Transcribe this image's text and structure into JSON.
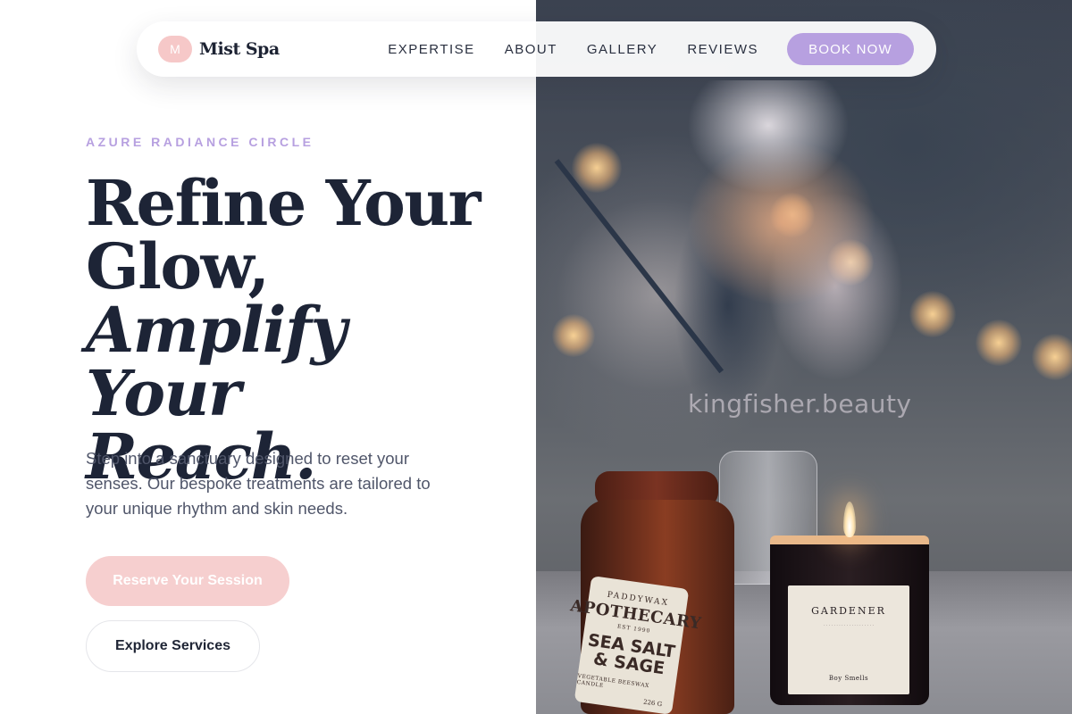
{
  "brand": {
    "logo_letter": "M",
    "name": "Mist Spa"
  },
  "nav": {
    "links": [
      "EXPERTISE",
      "ABOUT",
      "GALLERY",
      "REVIEWS"
    ],
    "cta": "BOOK NOW"
  },
  "hero": {
    "eyebrow": "AZURE RADIANCE CIRCLE",
    "headline_line1": "Refine Your",
    "headline_line2": "Glow,",
    "headline_line3": "Amplify Your",
    "headline_line4": "Reach.",
    "description": "Step into a sanctuary designed to reset your senses. Our bespoke treatments are tailored to your unique rhythm and skin needs.",
    "primary_button": "Reserve Your Session",
    "secondary_button": "Explore Services"
  },
  "photo": {
    "watermark": "kingfisher.beauty",
    "jar_label": {
      "brand": "PADDYWAX",
      "title": "APOTHECARY",
      "est": "EST 1990",
      "scent": "SEA SALT & SAGE",
      "note": "VEGETABLE BEESWAX CANDLE",
      "weight": "226 G"
    },
    "candle_label": {
      "title": "GARDENER",
      "maker": "Boy Smells"
    }
  },
  "colors": {
    "accent_lavender": "#b7a0e0",
    "accent_pink": "#f6cfcf",
    "text_dark": "#1d2436"
  }
}
